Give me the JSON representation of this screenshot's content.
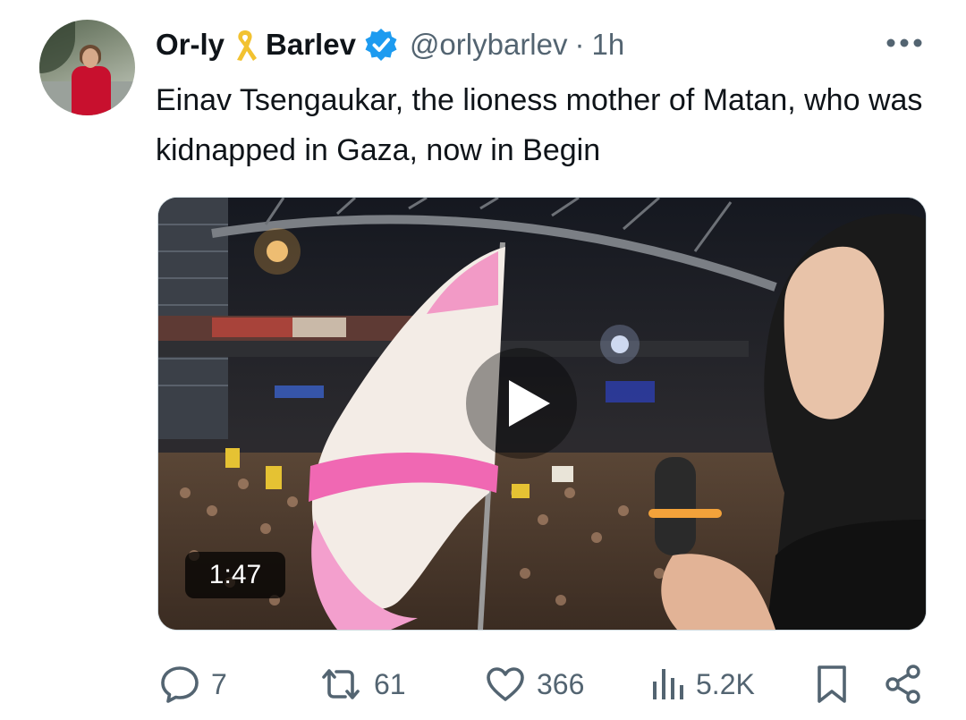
{
  "author": {
    "display_name_part1": "Or-ly",
    "display_name_part2": "Barlev",
    "handle": "@orlybarlev",
    "separator": "·",
    "time": "1h",
    "verified": true,
    "ribbon_icon": "yellow-ribbon-icon",
    "ribbon_color": "#f2c230",
    "verified_color": "#1d9bf0"
  },
  "tweet": {
    "text": "Einav Tsengaukar, the lioness mother of Matan, who was kidnapped in Gaza, now in Begin"
  },
  "media": {
    "type": "video",
    "duration": "1:47",
    "play_icon": "play-icon"
  },
  "actions": {
    "replies": "7",
    "reposts": "61",
    "likes": "366",
    "views": "5.2K"
  },
  "colors": {
    "text_primary": "#0f1419",
    "text_secondary": "#536471"
  }
}
